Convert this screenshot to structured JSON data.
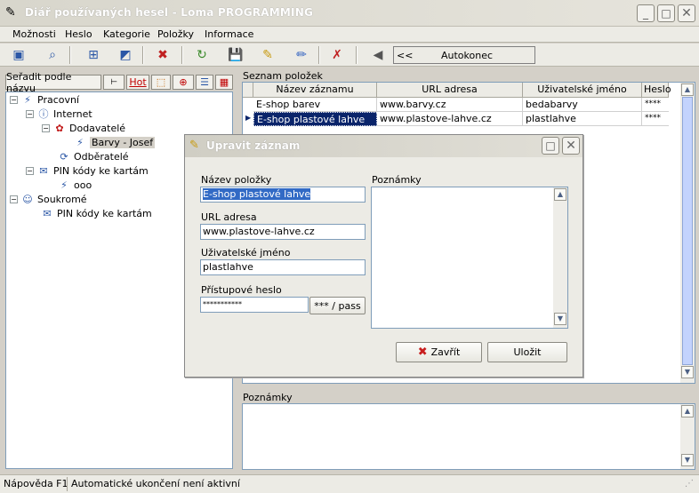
{
  "window": {
    "title": "Diář používaných hesel - Loma PROGRAMMING"
  },
  "menu": [
    "Možnosti",
    "Heslo",
    "Kategorie",
    "Položky",
    "Informace"
  ],
  "toolbar": {
    "auto_prefix": "<<",
    "auto_label": "Autokonec"
  },
  "sort": {
    "label": "Seřadit podle názvu",
    "hot_label": "Hot"
  },
  "tree": {
    "pracovni": "Pracovní",
    "internet": "Internet",
    "dodavatele": "Dodavatelé",
    "barvy": "Barvy - Josef",
    "odberatele": "Odběratelé",
    "pin1": "PIN kódy ke kartám",
    "ooo": "ooo",
    "soukrome": "Soukromé",
    "pin2": "PIN kódy ke kartám"
  },
  "list": {
    "label": "Seznam položek",
    "columns": [
      "Název záznamu",
      "URL adresa",
      "Uživatelské jméno",
      "Heslo"
    ],
    "rows": [
      {
        "name": "E-shop barev",
        "url": "www.barvy.cz",
        "user": "bedabarvy",
        "pass": "****"
      },
      {
        "name": "E-shop plastové lahve",
        "url": "www.plastove-lahve.cz",
        "user": "plastlahve",
        "pass": "****"
      }
    ]
  },
  "notes": {
    "label": "Poznámky"
  },
  "status": {
    "help": "Nápověda F1",
    "info": "Automatické ukončení není aktivní"
  },
  "dialog": {
    "title": "Upravit záznam",
    "name_label": "Název položky",
    "name_value": "E-shop plastové lahve",
    "url_label": "URL adresa",
    "url_value": "www.plastove-lahve.cz",
    "user_label": "Uživatelské jméno",
    "user_value": "plastlahve",
    "pass_label": "Přístupové heslo",
    "pass_value": "***********",
    "pass_toggle": "*** / pass",
    "notes_label": "Poznámky",
    "close_btn": "Zavřít",
    "save_btn": "Uložit"
  },
  "colors": {
    "selection": "#0a246a",
    "accent": "#316ac5"
  }
}
